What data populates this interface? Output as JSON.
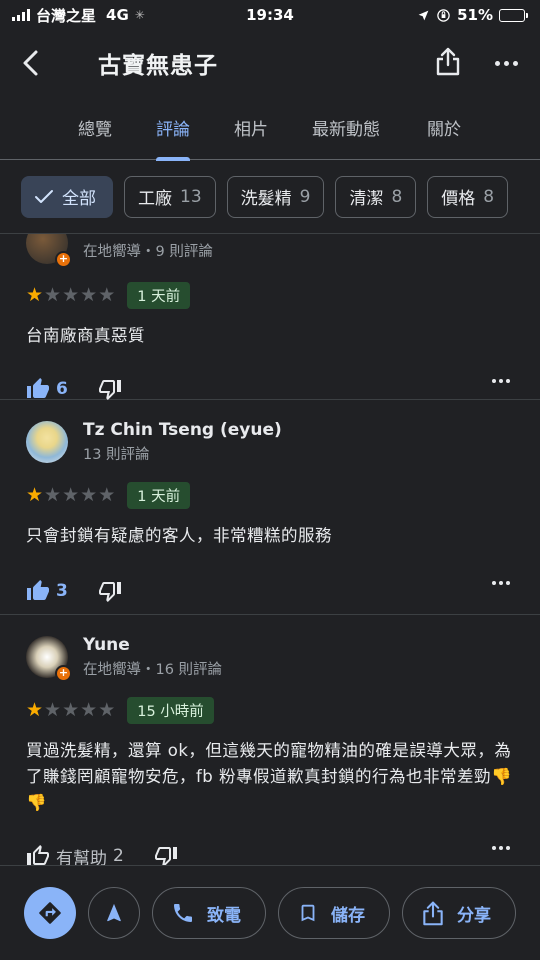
{
  "status_bar": {
    "carrier": "台灣之星",
    "network": "4G",
    "time": "19:34",
    "battery": "51%",
    "battery_level": 0.51
  },
  "header": {
    "title": "古寶無患子"
  },
  "tabs": [
    {
      "label": "總覽",
      "active": false
    },
    {
      "label": "評論",
      "active": true
    },
    {
      "label": "相片",
      "active": false
    },
    {
      "label": "最新動態",
      "active": false
    },
    {
      "label": "關於",
      "active": false
    }
  ],
  "filters": [
    {
      "label": "全部",
      "count": "",
      "selected": true
    },
    {
      "label": "工廠",
      "count": "13",
      "selected": false
    },
    {
      "label": "洗髮精",
      "count": "9",
      "selected": false
    },
    {
      "label": "清潔",
      "count": "8",
      "selected": false
    },
    {
      "label": "價格",
      "count": "8",
      "selected": false
    }
  ],
  "reviews": [
    {
      "author": "",
      "meta": "在地嚮導・9 則評論",
      "local_guide": true,
      "rating": 1,
      "time": "1 天前",
      "text": "台南廠商真惡質",
      "likes": "6",
      "liked": true
    },
    {
      "author": "Tz Chin Tseng (eyue)",
      "meta": "13 則評論",
      "local_guide": false,
      "rating": 1,
      "time": "1 天前",
      "text": "只會封鎖有疑慮的客人，非常糟糕的服務",
      "likes": "3",
      "liked": true
    },
    {
      "author": "Yune",
      "meta": "在地嚮導・16 則評論",
      "local_guide": true,
      "rating": 1,
      "time": "15 小時前",
      "text": "買過洗髮精，還算 ok，但這幾天的寵物精油的確是誤導大眾，為了賺錢罔顧寵物安危，fb 粉專假道歉真封鎖的行為也非常差勁👎👎",
      "likes": "2",
      "helpful_label": "有幫助",
      "liked": false
    }
  ],
  "bottom_actions": {
    "call": "致電",
    "save": "儲存",
    "share": "分享"
  },
  "colors": {
    "background": "#202124",
    "accent": "#8ab4f8",
    "star": "#f9ab00",
    "badge": "#e8710a"
  }
}
